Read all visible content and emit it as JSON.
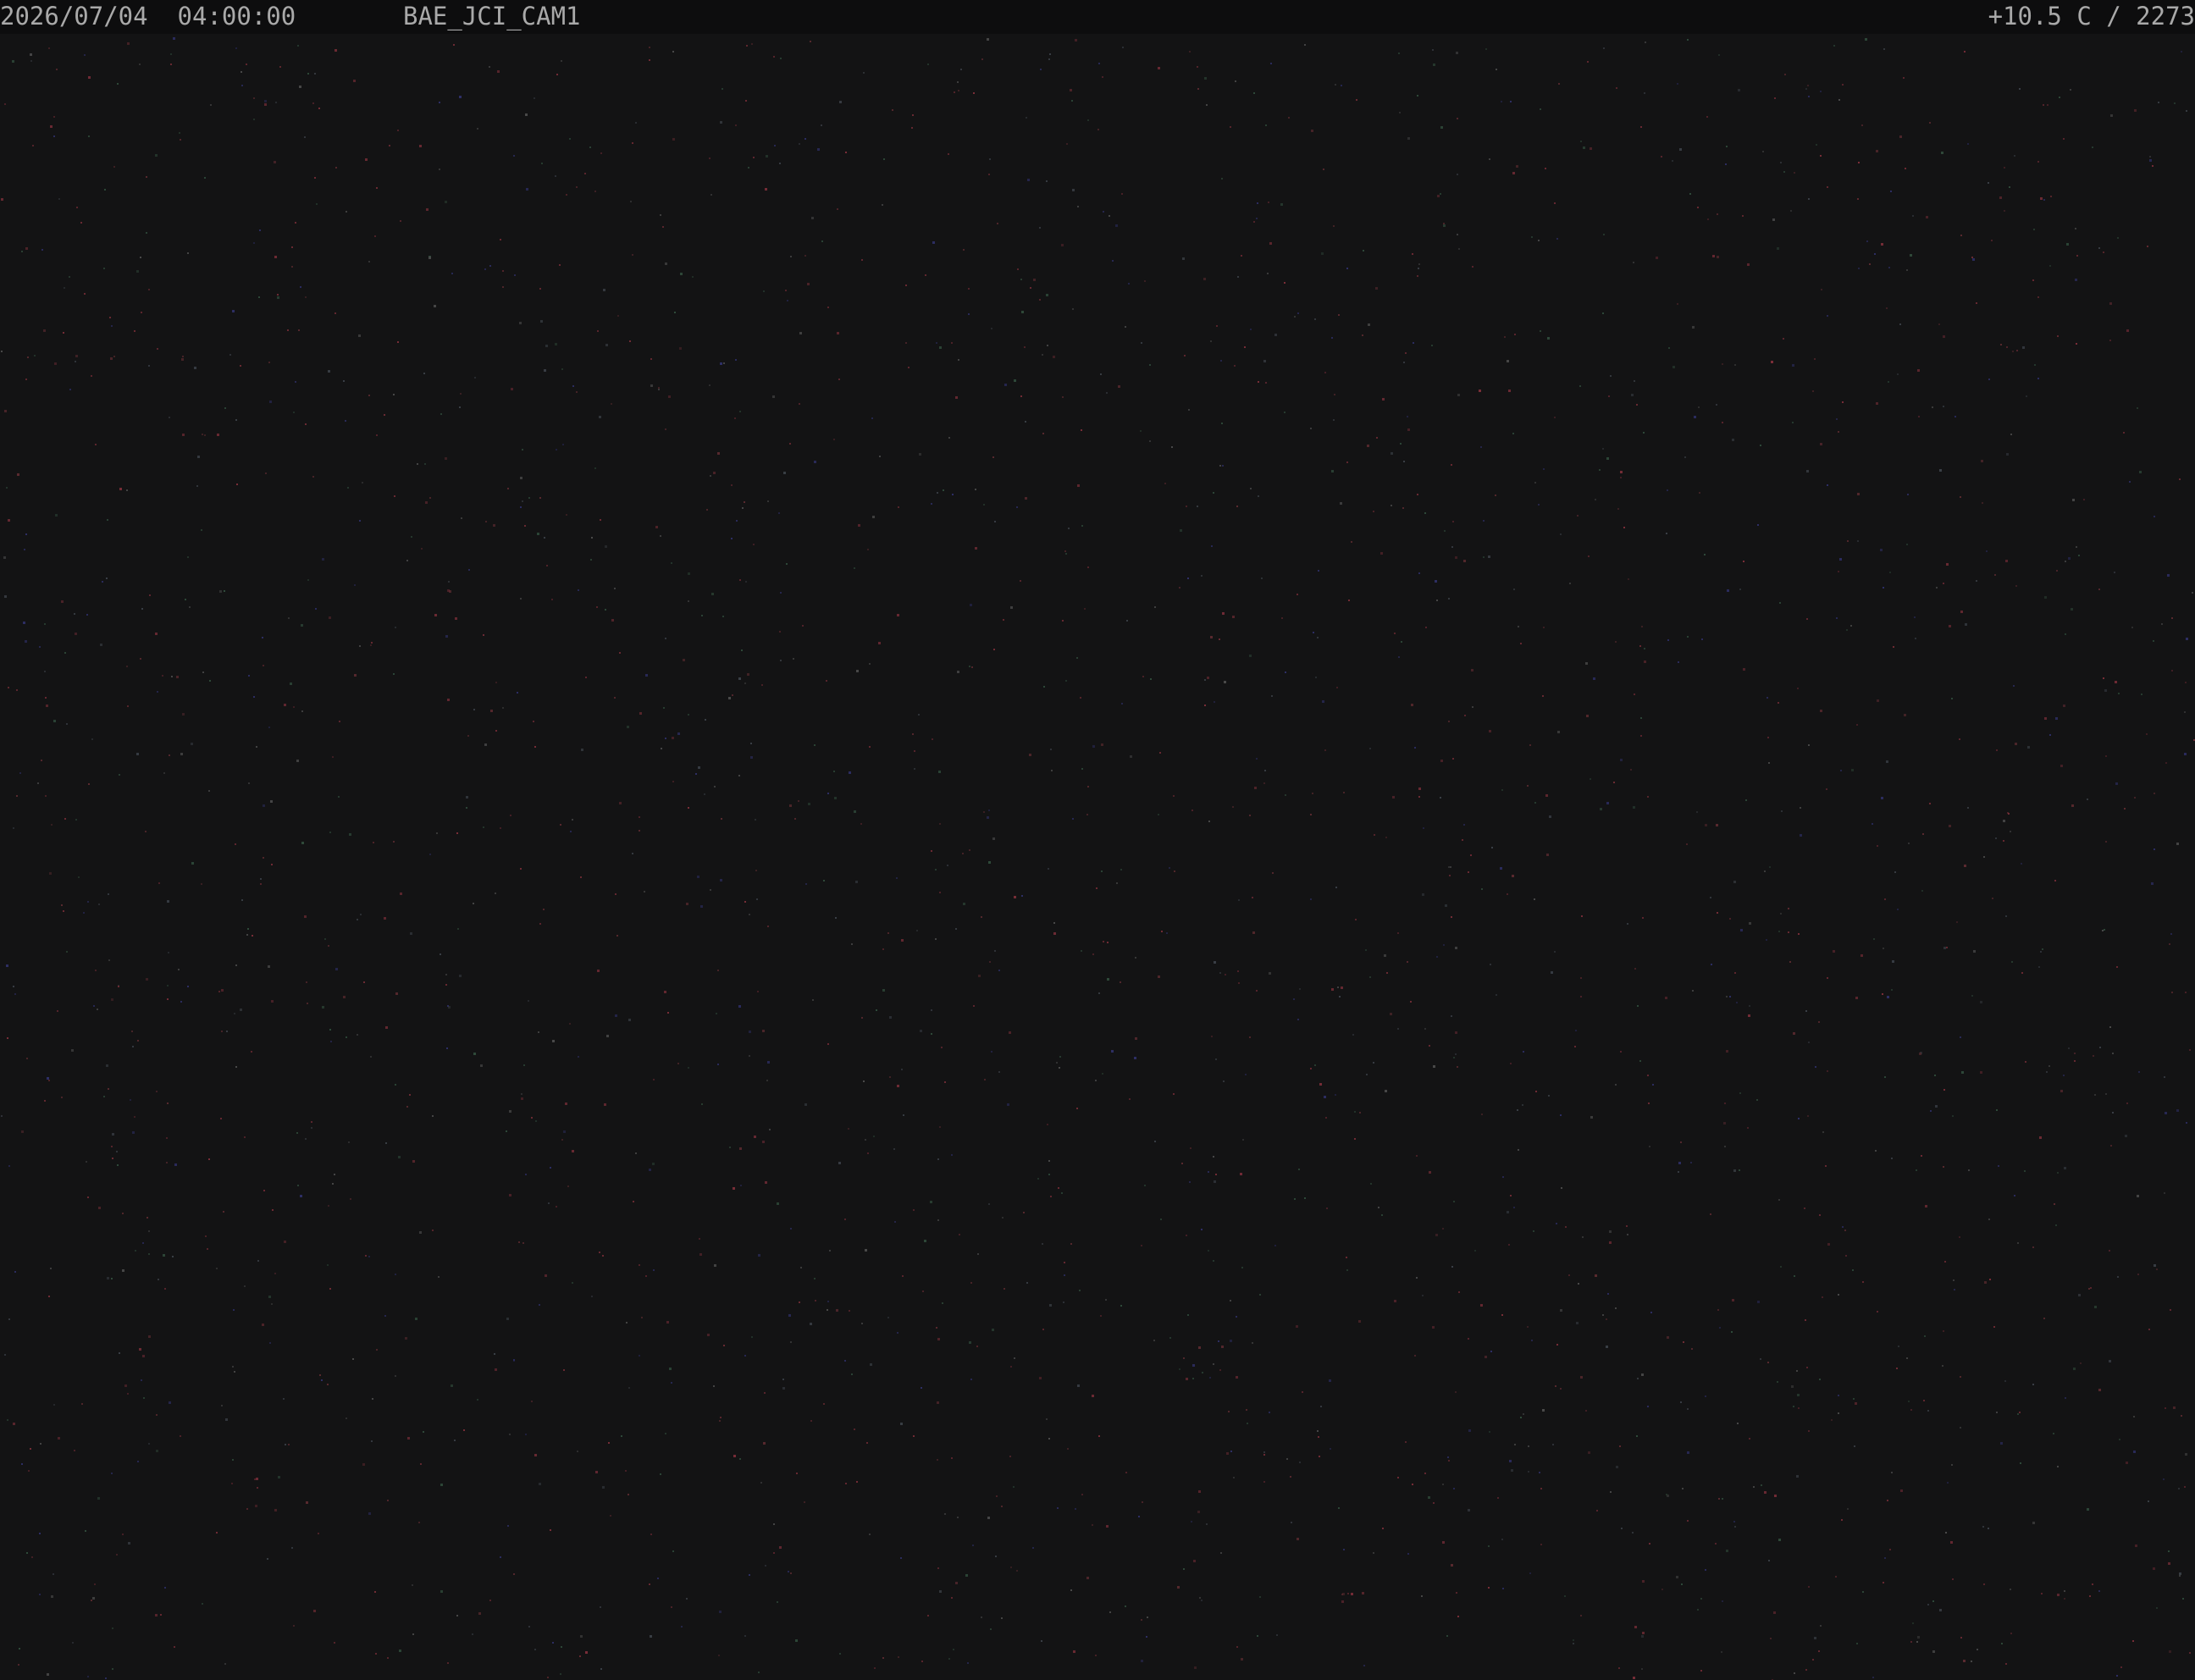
{
  "overlay": {
    "timestamp": "2026/07/04  04:00:00",
    "camera_id": "BAE_JCI_CAM1",
    "sensor_reading": "+10.5 C / 2273"
  },
  "colors": {
    "background": "#131314",
    "overlay_bar": "#0d0d0e",
    "overlay_text": "#a9a9a9"
  }
}
